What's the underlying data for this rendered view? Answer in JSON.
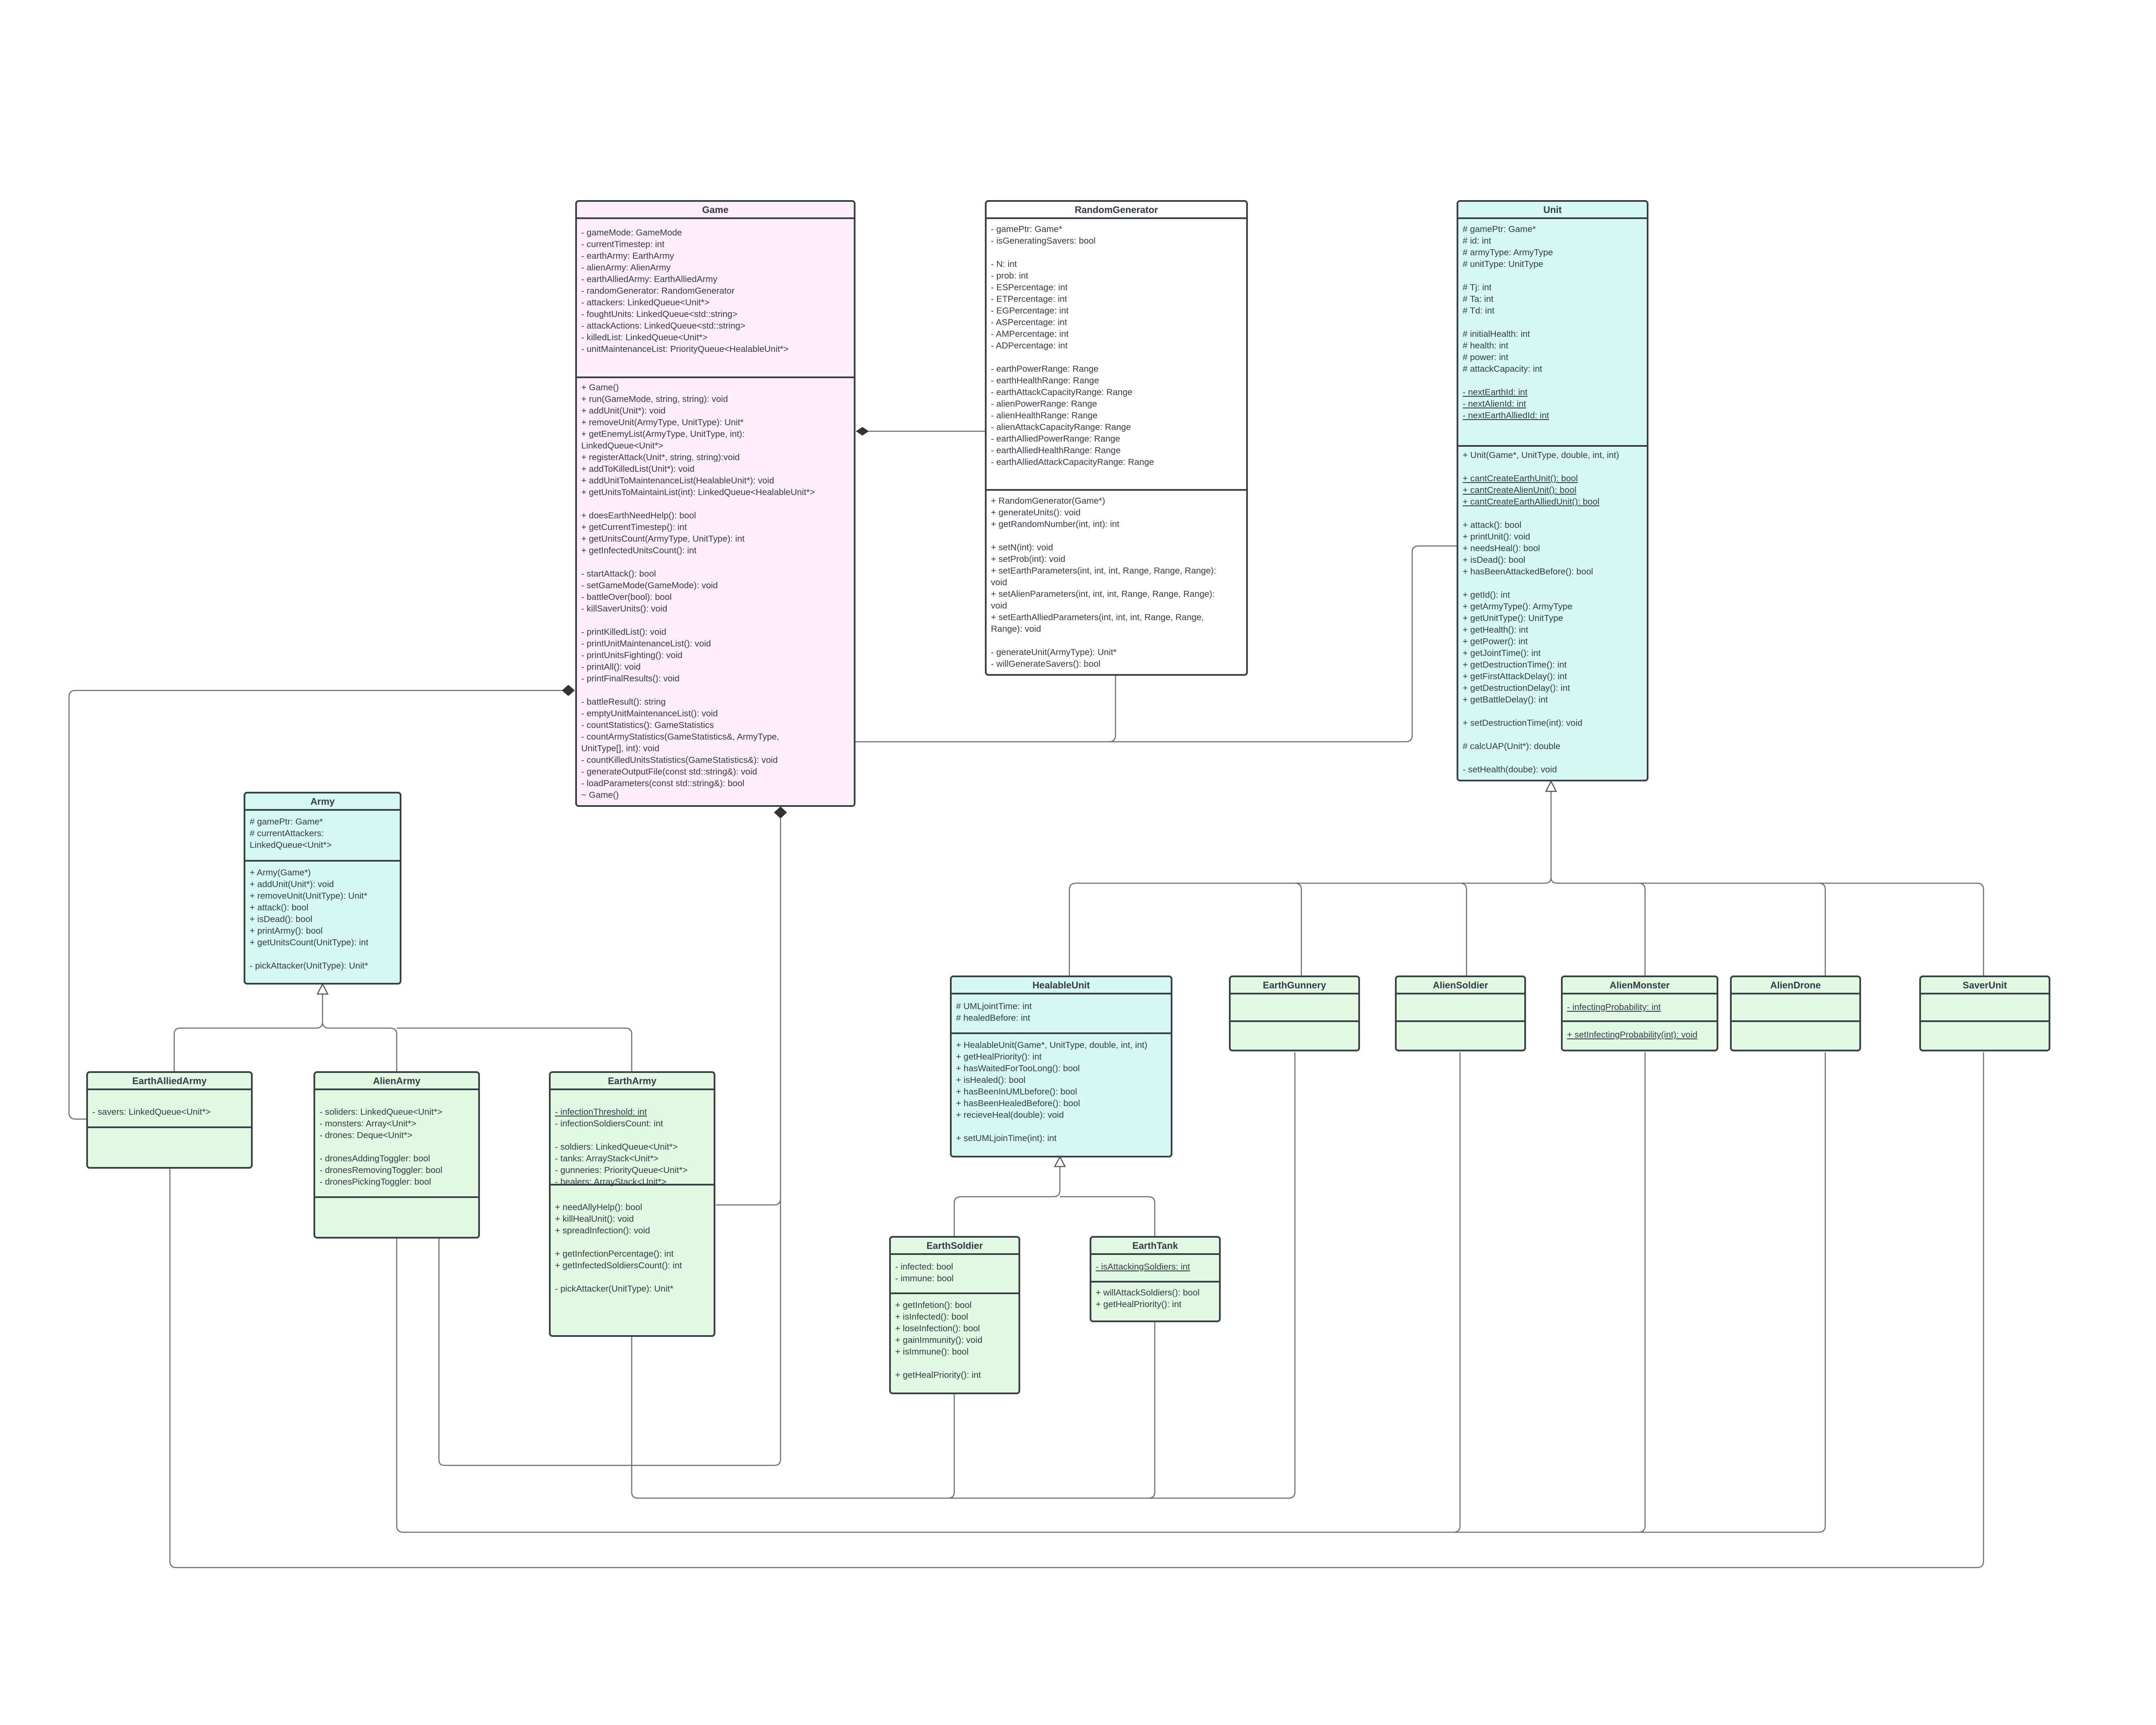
{
  "diagram": {
    "type": "UML class diagram",
    "colors": {
      "game": "#fdeef8",
      "random_generator": "#ffffff",
      "abstract_base": "#d6f8f2",
      "concrete": "#e1f8e1",
      "border": "#3a4048",
      "line": "#555a60"
    },
    "classes": {
      "game": {
        "name": "Game",
        "attributes": [
          "- gameMode: GameMode",
          "- currentTimestep: int",
          "- earthArmy: EarthArmy",
          "- alienArmy: AlienArmy",
          "- earthAlliedArmy: EarthAlliedArmy",
          "- randomGenerator: RandomGenerator",
          "- attackers: LinkedQueue<Unit*>",
          "- foughtUnits: LinkedQueue<std::string>",
          "- attackActions: LinkedQueue<std::string>",
          "- killedList: LinkedQueue<Unit*>",
          "- unitMaintenanceList: PriorityQueue<HealableUnit*>"
        ],
        "operations": [
          "+ Game()",
          "+ run(GameMode, string, string): void",
          "+ addUnit(Unit*): void",
          "+ removeUnit(ArmyType, UnitType): Unit*",
          "+ getEnemyList(ArmyType, UnitType, int):",
          "LinkedQueue<Unit*>",
          "+ registerAttack(Unit*, string, string):void",
          "+ addToKilledList(Unit*): void",
          "+ addUnitToMaintenanceList(HealableUnit*): void",
          "+ getUnitsToMaintainList(int): LinkedQueue<HealableUnit*>",
          "",
          "+ doesEarthNeedHelp(): bool",
          "+ getCurrentTimestep(): int",
          "+ getUnitsCount(ArmyType, UnitType): int",
          "+ getInfectedUnitsCount(): int",
          "",
          "- startAttack(): bool",
          "- setGameMode(GameMode): void",
          "- battleOver(bool): bool",
          "- killSaverUnits(): void",
          "",
          "- printKilledList(): void",
          "- printUnitMaintenanceList(): void",
          "- printUnitsFighting(): void",
          "- printAll(): void",
          "- printFinalResults(): void",
          "",
          "- battleResult(): string",
          "- emptyUnitMaintenanceList(): void",
          "- countStatistics(): GameStatistics",
          "- countArmyStatistics(GameStatistics&, ArmyType,",
          "UnitType[], int): void",
          "- countKilledUnitsStatistics(GameStatistics&): void",
          "- generateOutputFile(const std::string&): void",
          "- loadParameters(const std::string&): bool",
          "~ Game()"
        ]
      },
      "random_generator": {
        "name": "RandomGenerator",
        "attributes": [
          "- gamePtr: Game*",
          "- isGeneratingSavers: bool",
          "",
          "- N: int",
          "- prob: int",
          "- ESPercentage: int",
          "- ETPercentage: int",
          "- EGPercentage: int",
          "- ASPercentage: int",
          "- AMPercentage: int",
          "- ADPercentage: int",
          "",
          "- earthPowerRange: Range",
          "- earthHealthRange: Range",
          "- earthAttackCapacityRange: Range",
          "- alienPowerRange: Range",
          "- alienHealthRange: Range",
          "- alienAttackCapacityRange: Range",
          "- earthAlliedPowerRange: Range",
          "- earthAlliedHealthRange: Range",
          "- earthAlliedAttackCapacityRange: Range"
        ],
        "operations": [
          "+ RandomGenerator(Game*)",
          "+ generateUnits(): void",
          "+ getRandomNumber(int, int): int",
          "",
          "+ setN(int): void",
          "+ setProb(int): void",
          "+ setEarthParameters(int, int, int, Range, Range, Range):",
          "void",
          "+ setAlienParameters(int, int, int, Range, Range, Range):",
          "void",
          "+ setEarthAlliedParameters(int, int, int, Range, Range,",
          "Range): void",
          "",
          "- generateUnit(ArmyType): Unit*",
          "- willGenerateSavers(): bool"
        ]
      },
      "unit": {
        "name": "Unit",
        "attributes": [
          "# gamePtr: Game*",
          "# id: int",
          "# armyType: ArmyType",
          "# unitType: UnitType",
          "",
          "# Tj: int",
          "# Ta: int",
          "# Td: int",
          "",
          "# initialHealth: int",
          "# health: int",
          "# power: int",
          "# attackCapacity: int",
          "",
          "- nextEarthId: int",
          "- nextAlienId: int",
          "- nextEarthAlliedId: int"
        ],
        "static_attributes": [
          "- nextEarthId: int",
          "- nextAlienId: int",
          "- nextEarthAlliedId: int"
        ],
        "operations": [
          "+ Unit(Game*, UnitType, double, int, int)",
          "",
          "+ cantCreateEarthUnit(): bool",
          "+ cantCreateAlienUnit(): bool",
          "+ cantCreateEarthAlliedUnit(): bool",
          "",
          "+ attack(): bool",
          "+ printUnit(): void",
          "+ needsHeal(): bool",
          "+ isDead(): bool",
          "+ hasBeenAttackedBefore(): bool",
          "",
          "+ getId(): int",
          "+ getArmyType(): ArmyType",
          "+ getUnitType(): UnitType",
          "+ getHealth(): int",
          "+ getPower(): int",
          "+ getJointTime(): int",
          "+ getDestructionTime(): int",
          "+ getFirstAttackDelay(): int",
          "+ getDestructionDelay(): int",
          "+ getBattleDelay(): int",
          "",
          "+ setDestructionTime(int): void",
          "",
          "# calcUAP(Unit*): double",
          "",
          "- setHealth(doube): void"
        ],
        "static_operations": [
          "+ cantCreateEarthUnit(): bool",
          "+ cantCreateAlienUnit(): bool",
          "+ cantCreateEarthAlliedUnit(): bool"
        ]
      },
      "army": {
        "name": "Army",
        "attributes": [
          "# gamePtr: Game*",
          "# currentAttackers:",
          "LinkedQueue<Unit*>"
        ],
        "operations": [
          "+ Army(Game*)",
          "+ addUnit(Unit*): void",
          "+ removeUnit(UnitType): Unit*",
          "+ attack(): bool",
          "+ isDead(): bool",
          "+ printArmy(): bool",
          "+ getUnitsCount(UnitType): int",
          "",
          "- pickAttacker(UnitType): Unit*"
        ]
      },
      "earth_allied_army": {
        "name": "EarthAlliedArmy",
        "attributes": [
          "",
          "- savers: LinkedQueue<Unit*>"
        ],
        "operations": []
      },
      "alien_army": {
        "name": "AlienArmy",
        "attributes": [
          "",
          "- soliders: LinkedQueue<Unit*>",
          "- monsters: Array<Unit*>",
          "- drones: Deque<Unit*>",
          "",
          "- dronesAddingToggler: bool",
          "- dronesRemovingToggler: bool",
          "- dronesPickingToggler: bool"
        ],
        "operations": []
      },
      "earth_army": {
        "name": "EarthArmy",
        "attributes": [
          "",
          "- infectionThreshold: int",
          "- infectionSoldiersCount: int",
          "",
          "- soldiers: LinkedQueue<Unit*>",
          "- tanks: ArrayStack<Unit*>",
          "- gunneries: PriorityQueue<Unit*>",
          "- healers: ArrayStack<Unit*>"
        ],
        "static_attributes": [
          "- infectionThreshold: int"
        ],
        "operations": [
          "",
          "+ needAllyHelp(): bool",
          "+ killHealUnit(): void",
          "+ spreadInfection(): void",
          "",
          "+ getInfectionPercentage(): int",
          "+ getInfectedSoldiersCount(): int",
          "",
          "- pickAttacker(UnitType): Unit*"
        ]
      },
      "healable_unit": {
        "name": "HealableUnit",
        "attributes": [
          "# UMLjointTime: int",
          "# healedBefore: int"
        ],
        "operations": [
          "+ HealableUnit(Game*, UnitType, double, int, int)",
          "+ getHealPriority(): int",
          "+ hasWaitedForTooLong(): bool",
          "+ isHealed(): bool",
          "+ hasBeenInUMLbefore(): bool",
          "+ hasBeenHealedBefore(): bool",
          "+ recieveHeal(double): void",
          "",
          "+ setUMLjoinTime(int): int"
        ]
      },
      "earth_soldier": {
        "name": "EarthSoldier",
        "attributes": [
          "- infected: bool",
          "- immune: bool"
        ],
        "operations": [
          "+ getInfetion(): bool",
          "+ isInfected(): bool",
          "+ loseInfection(): bool",
          "+ gainImmunity(): void",
          "+ isImmune(): bool",
          "",
          "+ getHealPriority(): int"
        ]
      },
      "earth_tank": {
        "name": "EarthTank",
        "attributes": [
          "- isAttackingSoldiers: int"
        ],
        "static_attributes": [
          "- isAttackingSoldiers: int"
        ],
        "operations": [
          "+ willAttackSoldiers(): bool",
          "+ getHealPriority(): int"
        ]
      },
      "earth_gunnery": {
        "name": "EarthGunnery",
        "attributes": [],
        "operations": []
      },
      "alien_soldier": {
        "name": "AlienSoldier",
        "attributes": [],
        "operations": []
      },
      "alien_monster": {
        "name": "AlienMonster",
        "attributes": [
          "- infectingProbability: int"
        ],
        "static_attributes": [
          "- infectingProbability: int"
        ],
        "operations": [
          "+ setInfectingProbability(int): void"
        ],
        "static_operations": [
          "+ setInfectingProbability(int): void"
        ]
      },
      "alien_drone": {
        "name": "AlienDrone",
        "attributes": [],
        "operations": []
      },
      "saver_unit": {
        "name": "SaverUnit",
        "attributes": [],
        "operations": []
      }
    },
    "relationships": [
      {
        "type": "composition",
        "whole": "Game",
        "part": "RandomGenerator"
      },
      {
        "type": "composition",
        "whole": "Game",
        "part": "EarthAlliedArmy"
      },
      {
        "type": "composition",
        "whole": "Game",
        "part": "EarthArmy"
      },
      {
        "type": "composition",
        "whole": "Game",
        "part": "AlienArmy"
      },
      {
        "type": "association",
        "from": "Game",
        "to": "Unit"
      },
      {
        "type": "association",
        "from": "RandomGenerator",
        "to": "Game"
      },
      {
        "type": "generalization",
        "child": "EarthAlliedArmy",
        "parent": "Army"
      },
      {
        "type": "generalization",
        "child": "AlienArmy",
        "parent": "Army"
      },
      {
        "type": "generalization",
        "child": "EarthArmy",
        "parent": "Army"
      },
      {
        "type": "generalization",
        "child": "HealableUnit",
        "parent": "Unit"
      },
      {
        "type": "generalization",
        "child": "EarthGunnery",
        "parent": "Unit"
      },
      {
        "type": "generalization",
        "child": "AlienSoldier",
        "parent": "Unit"
      },
      {
        "type": "generalization",
        "child": "AlienMonster",
        "parent": "Unit"
      },
      {
        "type": "generalization",
        "child": "AlienDrone",
        "parent": "Unit"
      },
      {
        "type": "generalization",
        "child": "SaverUnit",
        "parent": "Unit"
      },
      {
        "type": "generalization",
        "child": "EarthSoldier",
        "parent": "HealableUnit"
      },
      {
        "type": "generalization",
        "child": "EarthTank",
        "parent": "HealableUnit"
      },
      {
        "type": "association",
        "from": "EarthArmy",
        "to": [
          "EarthSoldier",
          "EarthTank",
          "EarthGunnery"
        ]
      },
      {
        "type": "association",
        "from": "AlienArmy",
        "to": [
          "AlienSoldier",
          "AlienMonster",
          "AlienDrone"
        ]
      },
      {
        "type": "association",
        "from": "EarthAlliedArmy",
        "to": "SaverUnit"
      }
    ]
  }
}
